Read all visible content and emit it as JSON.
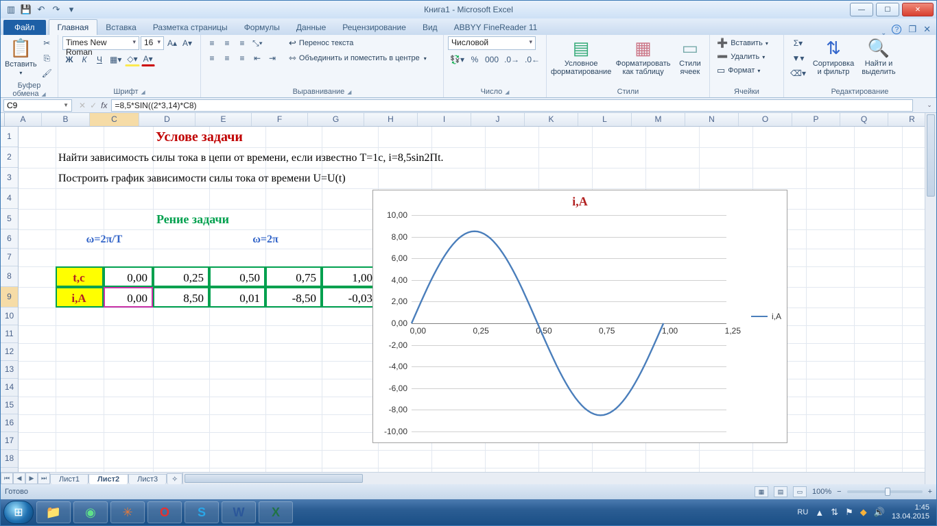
{
  "window": {
    "title": "Книга1 - Microsoft Excel"
  },
  "qat": {
    "save": "💾",
    "undo": "↶",
    "redo": "↷"
  },
  "tabs": {
    "file": "Файл",
    "items": [
      "Главная",
      "Вставка",
      "Разметка страницы",
      "Формулы",
      "Данные",
      "Рецензирование",
      "Вид",
      "ABBYY FineReader 11"
    ],
    "active": 0
  },
  "ribbon": {
    "clipboard": {
      "label": "Буфер обмена",
      "paste": "Вставить"
    },
    "font": {
      "label": "Шрифт",
      "name": "Times New Roman",
      "size": "16",
      "bold": "Ж",
      "italic": "К",
      "underline": "Ч"
    },
    "align": {
      "label": "Выравнивание",
      "wrap": "Перенос текста",
      "merge": "Объединить и поместить в центре"
    },
    "number": {
      "label": "Число",
      "format": "Числовой"
    },
    "styles": {
      "label": "Стили",
      "cond": "Условное форматирование",
      "table": "Форматировать как таблицу",
      "cell": "Стили ячеек"
    },
    "cells": {
      "label": "Ячейки",
      "insert": "Вставить",
      "delete": "Удалить",
      "format": "Формат"
    },
    "editing": {
      "label": "Редактирование",
      "sort": "Сортировка и фильтр",
      "find": "Найти и выделить"
    }
  },
  "namebox": "C9",
  "formula": "=8,5*SIN((2*3,14)*C8)",
  "columns": [
    "A",
    "B",
    "C",
    "D",
    "E",
    "F",
    "G",
    "H",
    "I",
    "J",
    "K",
    "L",
    "M",
    "N",
    "O",
    "P",
    "Q",
    "R"
  ],
  "content": {
    "title": "Услове задачи",
    "line1": "Найти зависимость силы тока в цепи от времени, если известно T=1c, i=8,5sin2Пt.",
    "line2": "Построить график зависимости силы тока от времени U=U(t)",
    "title2": "Рение задачи",
    "omega1": "ω=2π/T",
    "omega2": "ω=2π",
    "row_t_label": "t,c",
    "row_i_label": "i,A",
    "row_t": [
      "0,00",
      "0,25",
      "0,50",
      "0,75",
      "1,00"
    ],
    "row_i": [
      "0,00",
      "8,50",
      "0,01",
      "-8,50",
      "-0,03"
    ]
  },
  "chart_data": {
    "type": "line",
    "title": "i,A",
    "x": [
      0.0,
      0.25,
      0.5,
      0.75,
      1.0
    ],
    "y": [
      0.0,
      8.5,
      0.01,
      -8.5,
      -0.03
    ],
    "xlim": [
      0,
      1.25
    ],
    "ylim": [
      -10,
      10
    ],
    "yticks": [
      -10,
      -8,
      -6,
      -4,
      -2,
      0,
      2,
      4,
      6,
      8,
      10
    ],
    "ytick_labels": [
      "-10,00",
      "-8,00",
      "-6,00",
      "-4,00",
      "-2,00",
      "0,00",
      "2,00",
      "4,00",
      "6,00",
      "8,00",
      "10,00"
    ],
    "xticks": [
      0,
      0.25,
      0.5,
      0.75,
      1.0,
      1.25
    ],
    "xtick_labels": [
      "0,00",
      "0,25",
      "0,50",
      "0,75",
      "1,00",
      "1,25"
    ],
    "legend": "i,A"
  },
  "sheets": {
    "items": [
      "Лист1",
      "Лист2",
      "Лист3"
    ],
    "active": 1
  },
  "status": {
    "ready": "Готово",
    "zoom": "100%"
  },
  "taskbar": {
    "lang": "RU",
    "time": "1:45",
    "date": "13.04.2015"
  }
}
